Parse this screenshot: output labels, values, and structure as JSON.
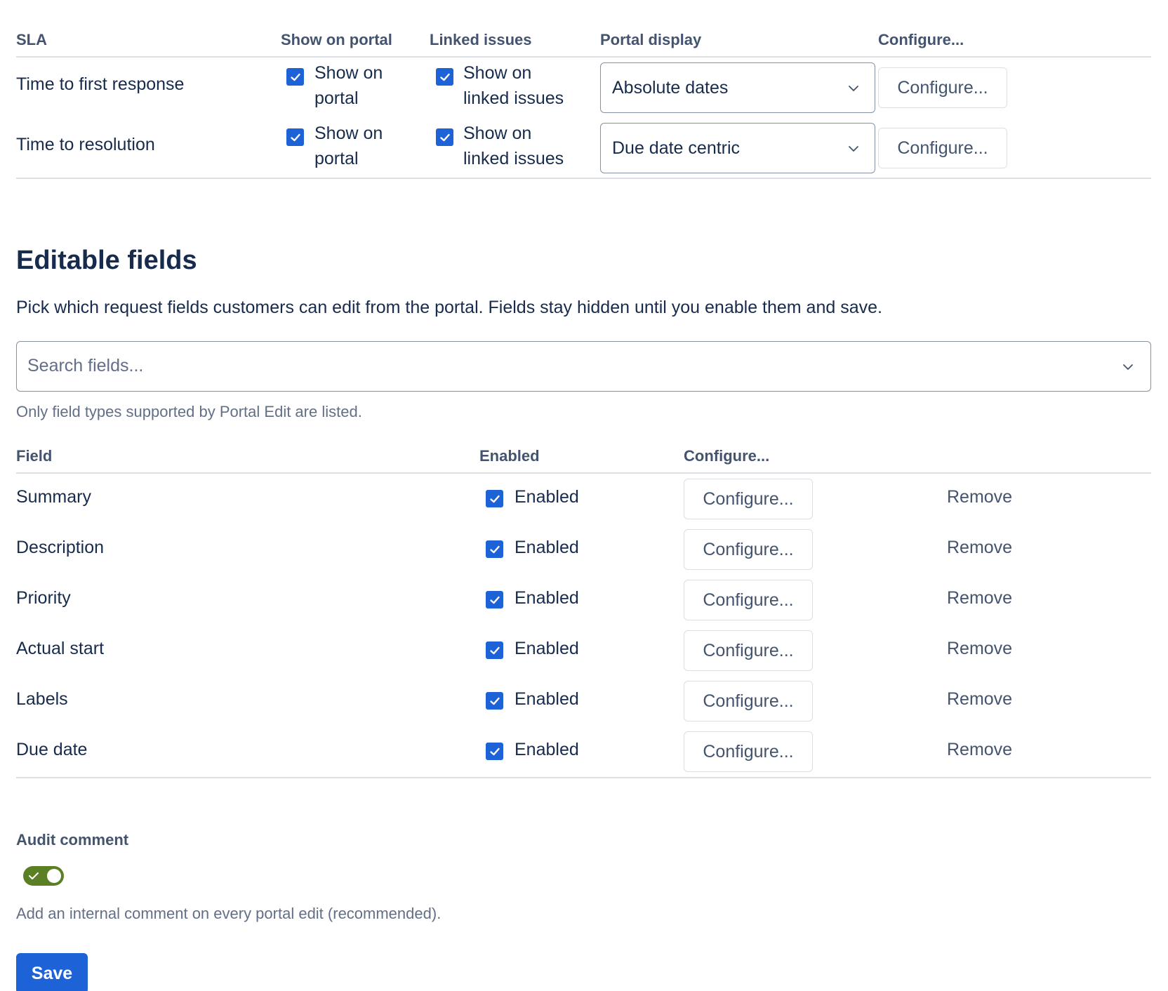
{
  "sla": {
    "headers": {
      "sla": "SLA",
      "show_on_portal": "Show on portal",
      "linked_issues": "Linked issues",
      "portal_display": "Portal display",
      "configure": "Configure..."
    },
    "rows": [
      {
        "name": "Time to first response",
        "portal_label_1": "Show on",
        "portal_label_2": "portal",
        "linked_label_1": "Show on",
        "linked_label_2": "linked issues",
        "show_on_portal": true,
        "show_on_linked": true,
        "display": "Absolute dates",
        "configure": "Configure..."
      },
      {
        "name": "Time to resolution",
        "portal_label_1": "Show on",
        "portal_label_2": "portal",
        "linked_label_1": "Show on",
        "linked_label_2": "linked issues",
        "show_on_portal": true,
        "show_on_linked": true,
        "display": "Due date centric",
        "configure": "Configure..."
      }
    ]
  },
  "editable": {
    "title": "Editable fields",
    "description": "Pick which request fields customers can edit from the portal. Fields stay hidden until you enable them and save.",
    "search_placeholder": "Search fields...",
    "hint": "Only field types supported by Portal Edit are listed.",
    "headers": {
      "field": "Field",
      "enabled": "Enabled",
      "configure": "Configure..."
    },
    "rows": [
      {
        "name": "Summary",
        "enabled_label": "Enabled",
        "configure": "Configure...",
        "remove": "Remove"
      },
      {
        "name": "Description",
        "enabled_label": "Enabled",
        "configure": "Configure...",
        "remove": "Remove"
      },
      {
        "name": "Priority",
        "enabled_label": "Enabled",
        "configure": "Configure...",
        "remove": "Remove"
      },
      {
        "name": "Actual start",
        "enabled_label": "Enabled",
        "configure": "Configure...",
        "remove": "Remove"
      },
      {
        "name": "Labels",
        "enabled_label": "Enabled",
        "configure": "Configure...",
        "remove": "Remove"
      },
      {
        "name": "Due date",
        "enabled_label": "Enabled",
        "configure": "Configure...",
        "remove": "Remove"
      }
    ]
  },
  "audit": {
    "label": "Audit comment",
    "enabled": true,
    "help": "Add an internal comment on every portal edit (recommended)."
  },
  "save_label": "Save",
  "colors": {
    "checkbox": "#1d62d7",
    "toggle_on": "#5b7f24",
    "primary_button": "#1d62d7"
  }
}
